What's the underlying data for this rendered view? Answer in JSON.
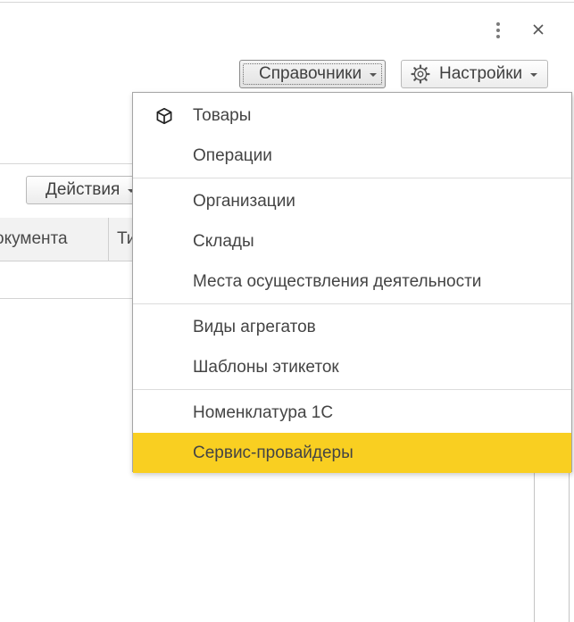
{
  "header": {
    "more_icon": "kebab-vertical-icon",
    "close_icon": "close-icon"
  },
  "toolbar": {
    "spravochniki_label": "Справочники",
    "nastroiki_label": "Настройки",
    "settings_icon": "gear-icon",
    "actions_label": "Действия"
  },
  "table": {
    "columns": [
      "окумента",
      "Ти"
    ]
  },
  "menu": {
    "groups": [
      [
        {
          "label": "Товары",
          "icon": "box-icon"
        },
        {
          "label": "Операции"
        }
      ],
      [
        {
          "label": "Организации"
        },
        {
          "label": "Склады"
        },
        {
          "label": "Места осуществления деятельности"
        }
      ],
      [
        {
          "label": "Виды агрегатов"
        },
        {
          "label": "Шаблоны этикеток"
        }
      ],
      [
        {
          "label": "Номенклатура 1С"
        },
        {
          "label": "Сервис-провайдеры",
          "highlighted": true
        }
      ]
    ]
  },
  "colors": {
    "highlight": "#f9cf21",
    "border": "#a5a5a5",
    "text": "#444444"
  }
}
